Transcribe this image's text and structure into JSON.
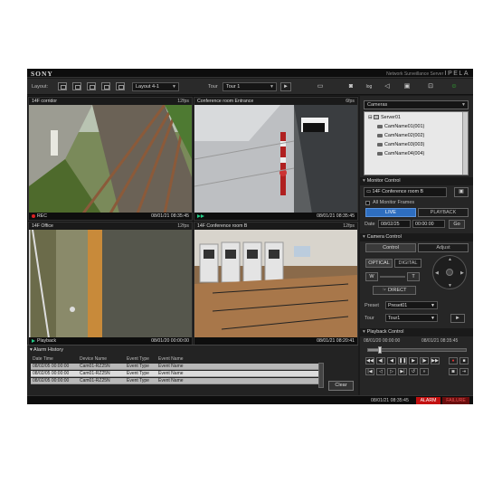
{
  "app": {
    "brand": "SONY",
    "product": "Network Surveillance Server",
    "product_logo": "IPELA"
  },
  "toolbar": {
    "layout_label": "Layout:",
    "layout_value": "Layout 4-1",
    "tour_label": "Tour",
    "tour_value": "Tour 1",
    "play_icon": "play-icon",
    "icons": [
      "monitor-icon",
      "camera-icon",
      "log-icon",
      "speaker-icon",
      "briefcase-icon",
      "settings-icon",
      "user-status-icon"
    ]
  },
  "cameras": [
    {
      "name": "14F corridor",
      "fps": "12fps",
      "mode": "REC",
      "time": "08/01/21 08:35:45"
    },
    {
      "name": "Conference room Entrance",
      "fps": "6fps",
      "mode": "",
      "time": "08/01/21 08:35:45"
    },
    {
      "name": "14F Office",
      "fps": "12fps",
      "mode": "Playback",
      "time": "08/01/20 00:00:00"
    },
    {
      "name": "14F Conference room B",
      "fps": "12fps",
      "mode": "",
      "time": "08/01/21 08:20:41"
    }
  ],
  "alarm_history": {
    "title": "Alarm History",
    "columns": [
      "Date Time",
      "Device Name",
      "Event Type",
      "Event Name"
    ],
    "rows": [
      [
        "08/02/05 00:00:00",
        "Cam01-RZ25N",
        "Event Type",
        "Event Name"
      ],
      [
        "08/02/05 00:00:00",
        "Cam01-RZ25N",
        "Event Type",
        "Event Name"
      ],
      [
        "08/02/05 00:00:00",
        "Cam01-RZ25N",
        "Event Type",
        "Event Name"
      ]
    ],
    "clear_label": "Clear"
  },
  "status": {
    "time": "08/01/21 08:35:45",
    "alarm": "ALARM",
    "failure": "FAILURE"
  },
  "right_panel": {
    "cameras_select": "Cameras",
    "tree": {
      "server": "Server01",
      "items": [
        "CamName01(001)",
        "CamName02(002)",
        "CamName03(003)",
        "CamName04(004)"
      ]
    },
    "monitor_control": {
      "title": "Monitor Control",
      "selected": "14F Conference room B",
      "all_frames": "All Monitor Frames",
      "live": "LIVE",
      "playback": "PLAYBACK",
      "date_label": "Date",
      "date_value": "08/02/25",
      "time_value": "00:00:00",
      "go": "Go"
    },
    "camera_control": {
      "title": "Camera Control",
      "tab_control": "Control",
      "tab_adjust": "Adjust",
      "optical": "OPTICAL",
      "digital": "DIGITAL",
      "wide": "W",
      "tele": "T",
      "direct": "DIRECT",
      "preset_label": "Preset",
      "preset_value": "Preset01",
      "tour_label": "Tour",
      "tour_value": "Tour1"
    },
    "playback_control": {
      "title": "Playback Control",
      "start_time": "08/01/20 00:00:00",
      "end_time": "08/01/21 08:35:45",
      "progress": 0.12
    }
  }
}
